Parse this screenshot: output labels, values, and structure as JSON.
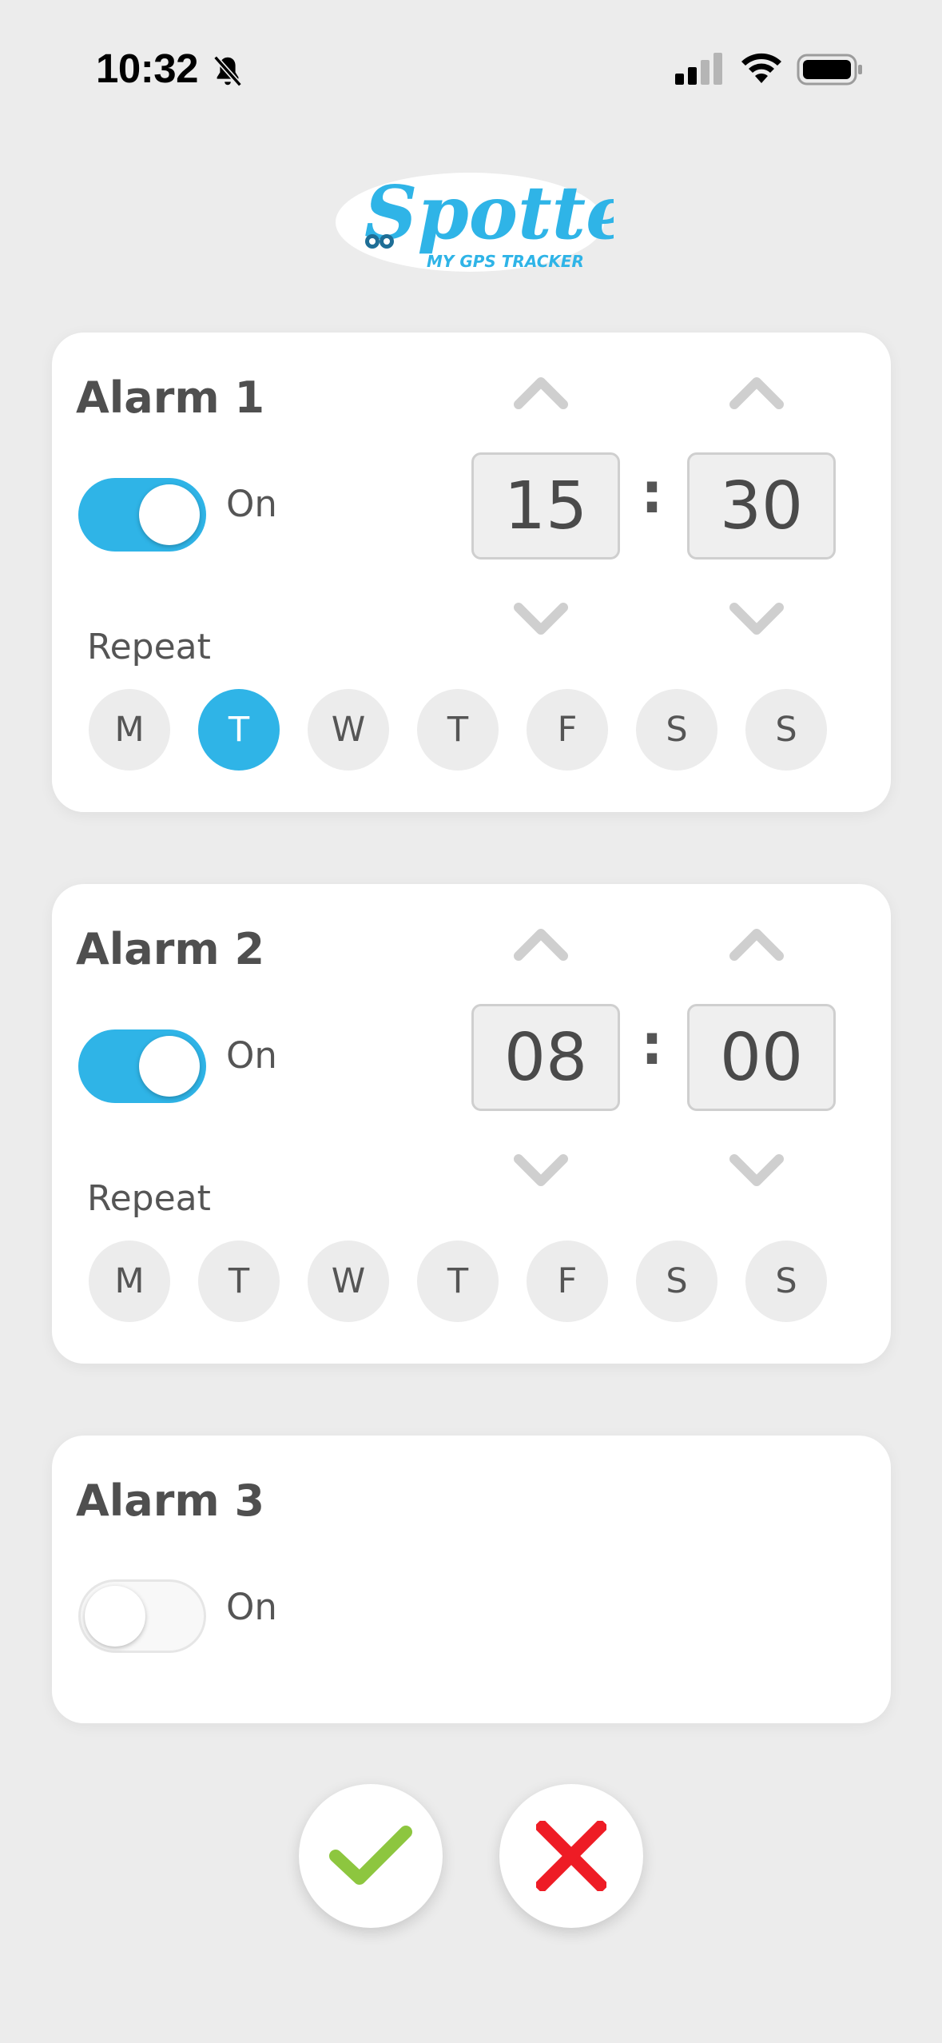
{
  "status_bar": {
    "time": "10:32",
    "icons": [
      "bell-slash-icon",
      "cellular-signal-icon",
      "wifi-icon",
      "battery-icon"
    ]
  },
  "logo": {
    "name": "Spotter",
    "tagline": "MY GPS TRACKER",
    "brand_color": "#2fb4e7"
  },
  "labels": {
    "toggle_on": "On",
    "repeat": "Repeat"
  },
  "day_labels": [
    "M",
    "T",
    "W",
    "T",
    "F",
    "S",
    "S"
  ],
  "alarms": [
    {
      "title": "Alarm 1",
      "enabled": true,
      "hour": "15",
      "minute": "30",
      "active_days": [
        false,
        true,
        false,
        false,
        false,
        false,
        false
      ]
    },
    {
      "title": "Alarm 2",
      "enabled": true,
      "hour": "08",
      "minute": "00",
      "active_days": [
        false,
        false,
        false,
        false,
        false,
        false,
        false
      ]
    },
    {
      "title": "Alarm 3",
      "enabled": false
    }
  ],
  "actions": {
    "confirm_icon": "checkmark-icon",
    "confirm_color": "#8dc63f",
    "cancel_icon": "close-icon",
    "cancel_color": "#ee1c25"
  },
  "colors": {
    "accent": "#2fb4e7",
    "background": "#ececec",
    "card": "#ffffff"
  }
}
